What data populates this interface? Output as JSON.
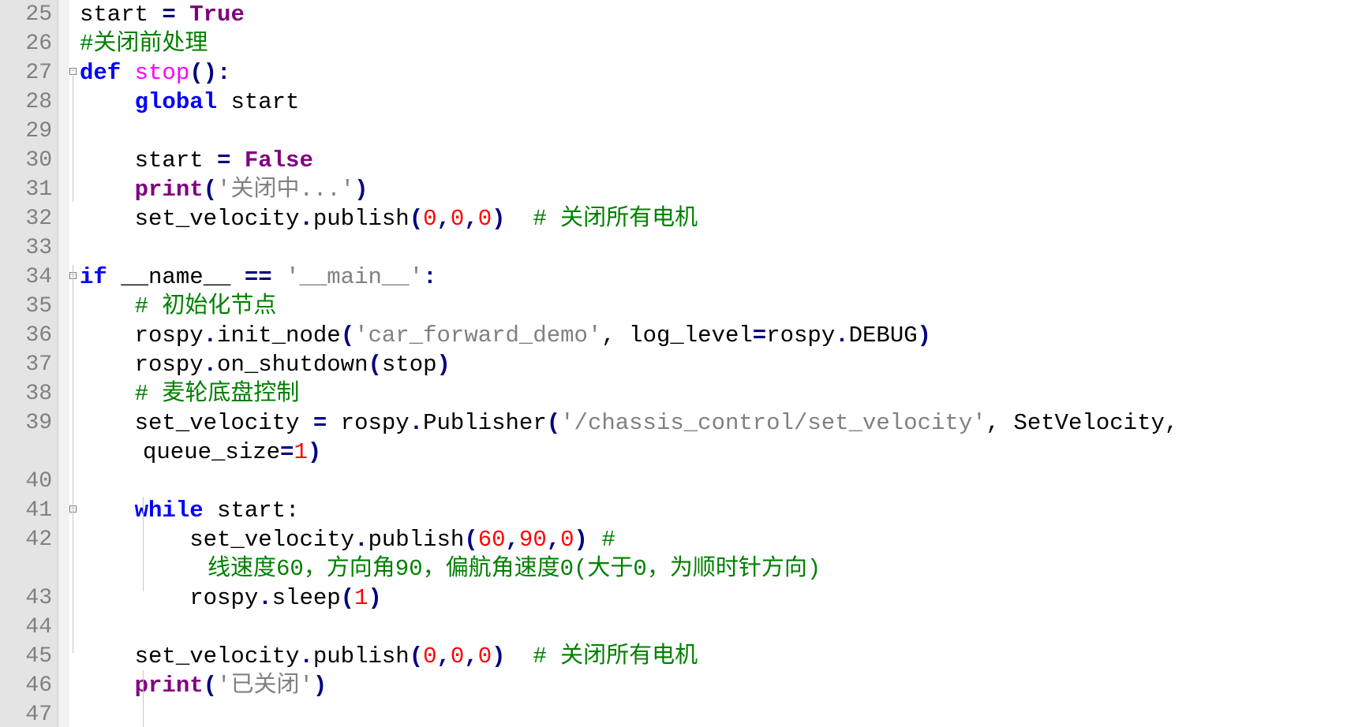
{
  "lines": [
    {
      "n": "25",
      "t": [
        [
          "start ",
          ""
        ],
        [
          "=",
          "op"
        ],
        [
          " ",
          ""
        ],
        [
          "True",
          "kw2"
        ]
      ]
    },
    {
      "n": "26",
      "t": [
        [
          "#关闭前处理",
          "cm"
        ]
      ]
    },
    {
      "n": "27",
      "fold": true,
      "t": [
        [
          "def",
          "kw"
        ],
        [
          " ",
          ""
        ],
        [
          "stop",
          "fn"
        ],
        [
          "():",
          "op"
        ]
      ]
    },
    {
      "n": "28",
      "t": [
        [
          "    ",
          ""
        ],
        [
          "global",
          "kw"
        ],
        [
          " start",
          ""
        ]
      ]
    },
    {
      "n": "29",
      "t": []
    },
    {
      "n": "30",
      "t": [
        [
          "    start ",
          ""
        ],
        [
          "=",
          "op"
        ],
        [
          " ",
          ""
        ],
        [
          "False",
          "kw2"
        ]
      ]
    },
    {
      "n": "31",
      "t": [
        [
          "    ",
          ""
        ],
        [
          "print",
          "kw2"
        ],
        [
          "(",
          "op"
        ],
        [
          "'关闭中...'",
          "str"
        ],
        [
          ")",
          "op"
        ]
      ]
    },
    {
      "n": "32",
      "t": [
        [
          "    set_velocity",
          ""
        ],
        [
          ".",
          "op"
        ],
        [
          "publish",
          ""
        ],
        [
          "(",
          "op"
        ],
        [
          "0",
          "num"
        ],
        [
          ",",
          "op"
        ],
        [
          "0",
          "num"
        ],
        [
          ",",
          "op"
        ],
        [
          "0",
          "num"
        ],
        [
          ")",
          "op"
        ],
        [
          "  ",
          ""
        ],
        [
          "# 关闭所有电机",
          "cm"
        ]
      ]
    },
    {
      "n": "33",
      "t": []
    },
    {
      "n": "34",
      "fold": true,
      "t": [
        [
          "if",
          "kw"
        ],
        [
          " __name__ ",
          ""
        ],
        [
          "==",
          "op"
        ],
        [
          " ",
          ""
        ],
        [
          "'__main__'",
          "str"
        ],
        [
          ":",
          "op"
        ]
      ]
    },
    {
      "n": "35",
      "t": [
        [
          "    ",
          ""
        ],
        [
          "# 初始化节点",
          "cm"
        ]
      ]
    },
    {
      "n": "36",
      "t": [
        [
          "    rospy",
          ""
        ],
        [
          ".",
          "op"
        ],
        [
          "init_node",
          ""
        ],
        [
          "(",
          "op"
        ],
        [
          "'car_forward_demo'",
          "str"
        ],
        [
          ", log_level",
          ""
        ],
        [
          "=",
          "op"
        ],
        [
          "rospy",
          ""
        ],
        [
          ".",
          "op"
        ],
        [
          "DEBUG",
          ""
        ],
        [
          ")",
          "op"
        ]
      ]
    },
    {
      "n": "37",
      "t": [
        [
          "    rospy",
          ""
        ],
        [
          ".",
          "op"
        ],
        [
          "on_shutdown",
          ""
        ],
        [
          "(",
          "op"
        ],
        [
          "stop",
          ""
        ],
        [
          ")",
          "op"
        ]
      ]
    },
    {
      "n": "38",
      "t": [
        [
          "    ",
          ""
        ],
        [
          "# 麦轮底盘控制",
          "cm"
        ]
      ]
    },
    {
      "n": "39",
      "t": [
        [
          "    set_velocity ",
          ""
        ],
        [
          "=",
          "op"
        ],
        [
          " rospy",
          ""
        ],
        [
          ".",
          "op"
        ],
        [
          "Publisher",
          ""
        ],
        [
          "(",
          "op"
        ],
        [
          "'/chassis_control/set_velocity'",
          "str"
        ],
        [
          ", SetVelocity,",
          ""
        ]
      ],
      "cont": [
        [
          "queue_size",
          ""
        ],
        [
          "=",
          "op"
        ],
        [
          "1",
          "num"
        ],
        [
          ")",
          "op"
        ]
      ]
    },
    {
      "n": "40",
      "t": []
    },
    {
      "n": "41",
      "fold": true,
      "t": [
        [
          "    ",
          ""
        ],
        [
          "while",
          "kw"
        ],
        [
          " start:",
          ""
        ]
      ]
    },
    {
      "n": "42",
      "t": [
        [
          "        set_velocity",
          ""
        ],
        [
          ".",
          "op"
        ],
        [
          "publish",
          ""
        ],
        [
          "(",
          "op"
        ],
        [
          "60",
          "num"
        ],
        [
          ",",
          "op"
        ],
        [
          "90",
          "num"
        ],
        [
          ",",
          "op"
        ],
        [
          "0",
          "num"
        ],
        [
          ")",
          "op"
        ],
        [
          " ",
          ""
        ],
        [
          "#",
          "cm"
        ]
      ],
      "cont_indent": 2,
      "cont": [
        [
          "线速度60，方向角90，偏航角速度0(大于0，为顺时针方向)",
          "cm"
        ]
      ]
    },
    {
      "n": "43",
      "t": [
        [
          "        rospy",
          ""
        ],
        [
          ".",
          "op"
        ],
        [
          "sleep",
          ""
        ],
        [
          "(",
          "op"
        ],
        [
          "1",
          "num"
        ],
        [
          ")",
          "op"
        ]
      ]
    },
    {
      "n": "44",
      "t": []
    },
    {
      "n": "45",
      "t": [
        [
          "    set_velocity",
          ""
        ],
        [
          ".",
          "op"
        ],
        [
          "publish",
          ""
        ],
        [
          "(",
          "op"
        ],
        [
          "0",
          "num"
        ],
        [
          ",",
          "op"
        ],
        [
          "0",
          "num"
        ],
        [
          ",",
          "op"
        ],
        [
          "0",
          "num"
        ],
        [
          ")",
          "op"
        ],
        [
          "  ",
          ""
        ],
        [
          "# 关闭所有电机",
          "cm"
        ]
      ]
    },
    {
      "n": "46",
      "t": [
        [
          "    ",
          ""
        ],
        [
          "print",
          "kw2"
        ],
        [
          "(",
          "op"
        ],
        [
          "'已关闭'",
          "str"
        ],
        [
          ")",
          "op"
        ]
      ]
    },
    {
      "n": "47",
      "t": []
    }
  ]
}
